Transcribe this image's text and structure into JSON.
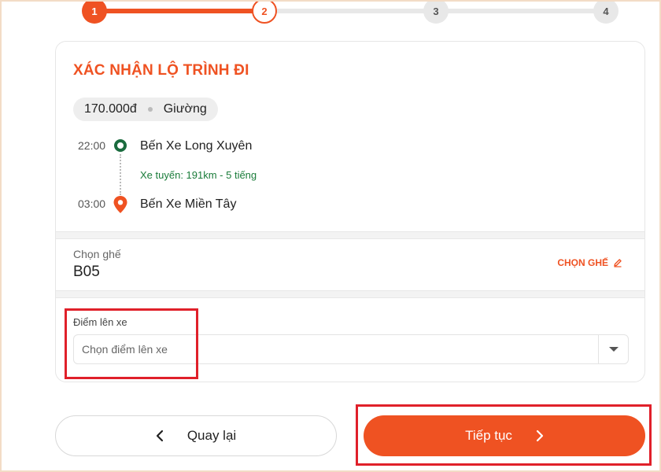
{
  "stepper": {
    "steps": [
      {
        "label": "1",
        "state": "done"
      },
      {
        "label": "2",
        "state": "active"
      },
      {
        "label": "3",
        "state": "todo"
      },
      {
        "label": "4",
        "state": "todo"
      }
    ]
  },
  "card": {
    "title": "XÁC NHẬN LỘ TRÌNH ĐI",
    "ticket": {
      "price": "170.000đ",
      "seat_type": "Giường"
    },
    "route": {
      "origin": {
        "time": "22:00",
        "name": "Bến Xe Long Xuyên"
      },
      "info": "Xe tuyến: 191km - 5 tiếng",
      "destination": {
        "time": "03:00",
        "name": "Bến Xe Miền Tây"
      }
    },
    "seat": {
      "label": "Chọn ghế",
      "value": "B05",
      "action": "CHỌN GHẾ"
    },
    "pickup": {
      "label": "Điểm lên xe",
      "placeholder": "Chọn điểm lên xe"
    }
  },
  "actions": {
    "back_label": "Quay lại",
    "continue_label": "Tiếp tục"
  },
  "colors": {
    "brand": "#ef5222",
    "route_green": "#1a7c3a",
    "origin_marker": "#1a6b3e",
    "highlight": "#e0202a"
  },
  "icons": {
    "origin": "origin-dot-icon",
    "destination": "location-pin-icon",
    "edit": "pencil-icon",
    "dropdown": "caret-down-icon",
    "back": "chevron-left-icon",
    "forward": "chevron-right-icon"
  }
}
